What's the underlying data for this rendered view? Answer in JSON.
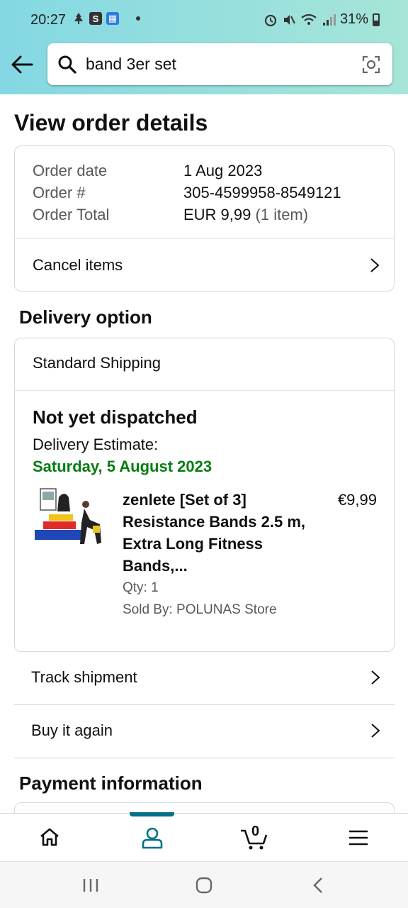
{
  "status_bar": {
    "time": "20:27",
    "battery": "31%"
  },
  "search": {
    "query": "band 3er set"
  },
  "page": {
    "title": "View order details"
  },
  "order_summary": {
    "date_label": "Order date",
    "date_value": "1 Aug 2023",
    "number_label": "Order #",
    "number_value": "305-4599958-8549121",
    "total_label": "Order Total",
    "total_value": "EUR 9,99",
    "total_items": "(1 item)",
    "cancel_label": "Cancel items"
  },
  "delivery": {
    "heading": "Delivery option",
    "method": "Standard Shipping",
    "status": "Not yet dispatched",
    "estimate_label": "Delivery Estimate:",
    "estimate_date": "Saturday, 5 August 2023",
    "estimate_color": "#067d12"
  },
  "product": {
    "title": "zenlete [Set of 3] Resistance Bands 2.5 m, Extra Long Fitness Bands,...",
    "price": "€9,99",
    "qty": "Qty: 1",
    "seller": "Sold By: POLUNAS Store"
  },
  "actions": {
    "track": "Track shipment",
    "buy_again": "Buy it again"
  },
  "payment": {
    "heading": "Payment information"
  },
  "bottom_nav": {
    "cart_count": "0",
    "selected": "account",
    "accent": "#007185"
  }
}
